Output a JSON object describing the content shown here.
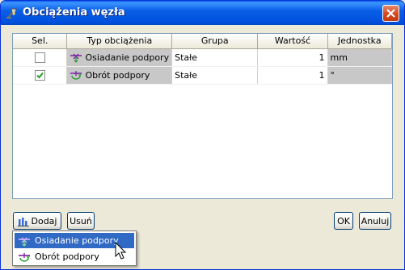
{
  "window": {
    "title": "Obciążenia węzła",
    "app_icon": "lamp-icon",
    "close_icon": "close-icon"
  },
  "grid": {
    "columns": [
      "Sel.",
      "Typ obciążenia",
      "Grupa",
      "Wartość",
      "Jednostka"
    ],
    "rows": [
      {
        "selected": false,
        "type": "Osiadanie podpory",
        "type_icon": "support-settlement-icon",
        "group": "Stałe",
        "value": "1",
        "unit": "mm"
      },
      {
        "selected": true,
        "type": "Obrót podpory",
        "type_icon": "support-rotation-icon",
        "group": "Stałe",
        "value": "1",
        "unit": "°"
      }
    ]
  },
  "buttons": {
    "add_label": "Dodaj",
    "add_icon": "add-load-icon",
    "remove_label": "Usuń",
    "ok_label": "OK",
    "cancel_label": "Anuluj"
  },
  "dropdown": {
    "items": [
      {
        "label": "Osiadanie podpory",
        "icon": "support-settlement-icon",
        "highlighted": true
      },
      {
        "label": "Obrót podpory",
        "icon": "support-rotation-icon",
        "highlighted": false
      }
    ]
  },
  "colors": {
    "titlebar": "#0a5fe6",
    "selection": "#316ac5",
    "readonly_cell": "#c8c8c8"
  }
}
